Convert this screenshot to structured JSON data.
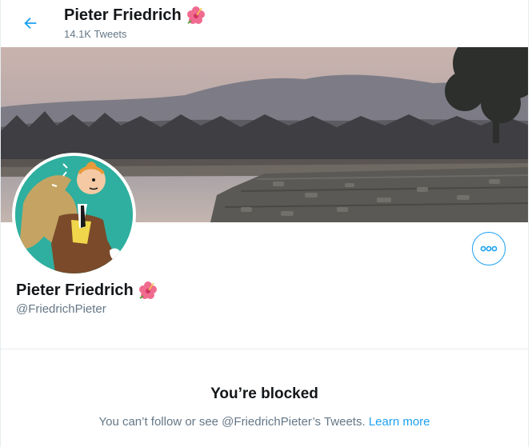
{
  "header": {
    "title": "Pieter Friedrich",
    "tweet_count": "14.1K Tweets"
  },
  "profile": {
    "display_name": "Pieter Friedrich",
    "handle": "@FriedrichPieter",
    "name_emoji": "hibiscus-flower-icon"
  },
  "blocked": {
    "title": "You’re blocked",
    "message": "You can’t follow or see @FriedrichPieter’s Tweets.",
    "link_label": "Learn more"
  },
  "colors": {
    "accent": "#1da1f2",
    "secondary_text": "#657786",
    "avatar_bg": "#2eaf9f"
  }
}
